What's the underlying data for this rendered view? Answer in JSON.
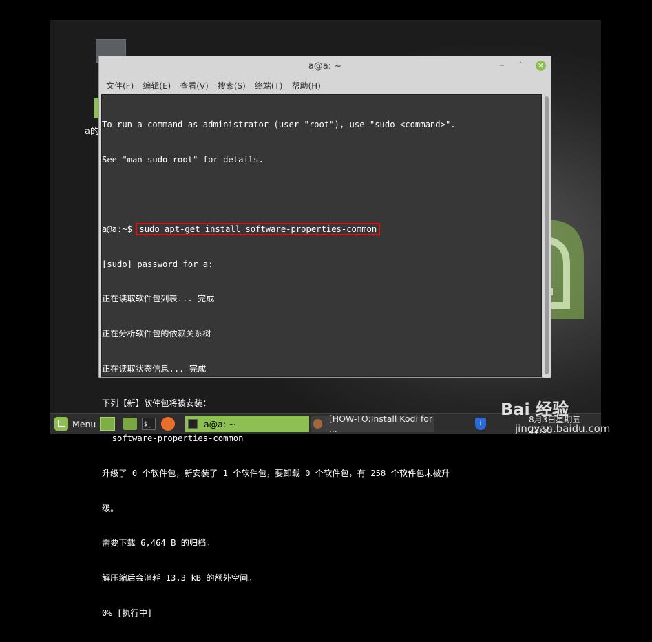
{
  "window": {
    "title": "a@a: ~",
    "min_glyph": "‒",
    "max_glyph": "˄",
    "close_glyph": "✕"
  },
  "menubar": [
    {
      "label": "文件(F)"
    },
    {
      "label": "编辑(E)"
    },
    {
      "label": "查看(V)"
    },
    {
      "label": "搜索(S)"
    },
    {
      "label": "终端(T)"
    },
    {
      "label": "帮助(H)"
    }
  ],
  "terminal": {
    "lines": [
      "To run a command as administrator (user \"root\"), use \"sudo <command>\".",
      "See \"man sudo_root\" for details.",
      "",
      "",
      "[sudo] password for a:",
      "正在读取软件包列表... 完成",
      "正在分析软件包的依赖关系树",
      "正在读取状态信息... 完成",
      "下列【新】软件包将被安装：",
      "  software-properties-common",
      "升级了 0 个软件包，新安装了 1 个软件包，要卸载 0 个软件包，有 258 个软件包未被升",
      "级。",
      "需要下载 6,464 B 的归档。",
      "解压缩后会消耗 13.3 kB 的额外空间。",
      "0% [执行中]"
    ],
    "prompt": "a@a:~$ ",
    "command": "sudo apt-get install software-properties-common"
  },
  "desktop": {
    "label": "a的"
  },
  "taskbar": {
    "menu_label": "Menu",
    "terminal_glyph": "$_",
    "tasks": [
      {
        "label": "a@a: ~",
        "active": true
      },
      {
        "label": "[HOW-TO:Install Kodi for ...",
        "active": false
      }
    ],
    "shield_glyph": "i",
    "clock": "8月3日星期五 22:55"
  },
  "watermark": {
    "text": "Bai 经验",
    "url": "jingyan.baidu.com"
  },
  "colors": {
    "accent": "#8dbf52",
    "terminal_bg": "#373737",
    "highlight_box": "#e01010"
  }
}
